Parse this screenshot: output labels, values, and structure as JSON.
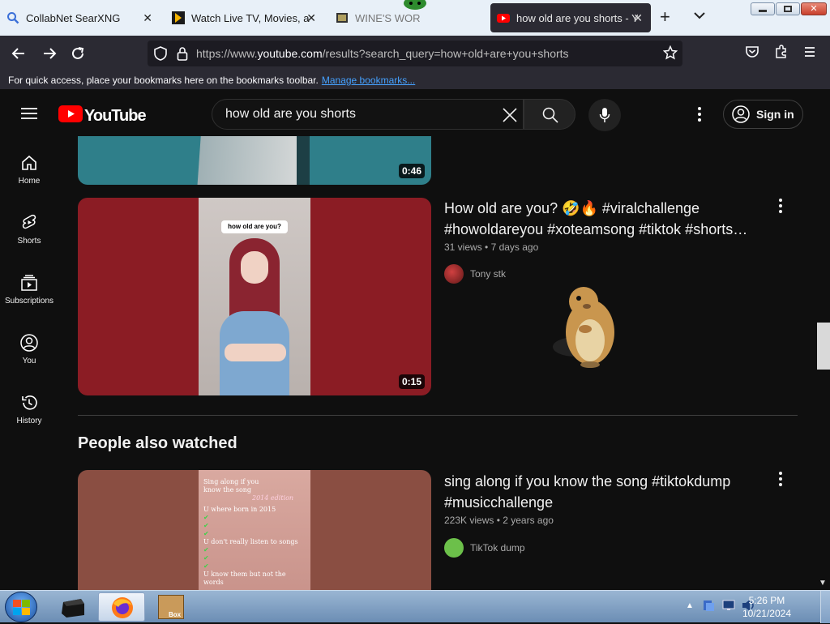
{
  "browser": {
    "tabs": [
      {
        "title": "CollabNet SearXNG",
        "icon": "search-icon"
      },
      {
        "title": "Watch Live TV, Movies, and",
        "icon": "play-triangle-icon"
      },
      {
        "title": "WINE'S WORLD",
        "icon": "film-icon"
      },
      {
        "title": "how old are you shorts - Yo",
        "icon": "youtube-icon",
        "active": true
      }
    ],
    "url_prefix": "https://www.",
    "url_domain": "youtube.com",
    "url_path": "/results?search_query=how+old+are+you+shorts",
    "bookmarks_message": "For quick access, place your bookmarks here on the bookmarks toolbar.",
    "bookmarks_link": "Manage bookmarks..."
  },
  "youtube": {
    "logo_text": "YouTube",
    "search_value": "how old are you shorts",
    "sign_in": "Sign in",
    "sidebar": [
      {
        "label": "Home",
        "icon": "home-icon"
      },
      {
        "label": "Shorts",
        "icon": "shorts-icon"
      },
      {
        "label": "Subscriptions",
        "icon": "subscriptions-icon"
      },
      {
        "label": "You",
        "icon": "you-icon"
      },
      {
        "label": "History",
        "icon": "history-icon"
      }
    ],
    "prev_video": {
      "duration": "0:46"
    },
    "video1": {
      "title_line1": "How old are you? 🤣🔥 #viralchallenge",
      "title_line2": "#howoldareyou #xoteamsong #tiktok #shorts…",
      "views": "31 views",
      "age": "7 days ago",
      "channel": "Tony stk",
      "duration": "0:15",
      "overlay_text": "how old are you?"
    },
    "section_title": "People also watched",
    "video2": {
      "title_line1": "sing along if you know the song #tiktokdump",
      "title_line2": "#musicchallenge",
      "views": "223K views",
      "age": "2 years ago",
      "channel": "TikTok dump",
      "thumb_lines": [
        "Sing along if you",
        "know the song",
        "2014 edition",
        "U where born in 2015",
        "U don't really listen to songs",
        "U know them but not the words"
      ]
    }
  },
  "taskbar": {
    "time": "5:26 PM",
    "date": "10/21/2024",
    "box_label": "Box"
  },
  "colors": {
    "yt_red": "#ff0000",
    "thumb_red": "#8b1c24",
    "link_blue": "#45a1ff"
  }
}
